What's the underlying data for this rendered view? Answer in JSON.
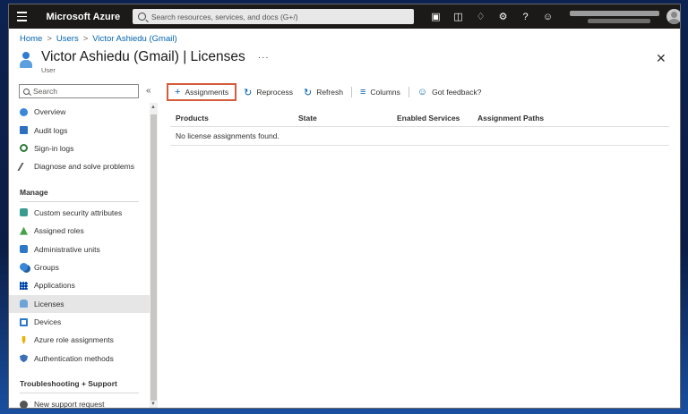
{
  "topbar": {
    "brand": "Microsoft Azure",
    "search_placeholder": "Search resources, services, and docs (G+/)",
    "icons": [
      "cloud-shell-icon",
      "directory-filter-icon",
      "notifications-icon",
      "settings-icon",
      "help-icon",
      "feedback-icon"
    ]
  },
  "breadcrumb": [
    "Home",
    "Users",
    "Victor Ashiedu (Gmail)"
  ],
  "header": {
    "title": "Victor Ashiedu (Gmail) | Licenses",
    "subtitle": "User",
    "more": "···"
  },
  "sidebar": {
    "search_placeholder": "Search",
    "collapse": "«",
    "items_top": [
      {
        "label": "Overview",
        "icon": "overview-icon"
      },
      {
        "label": "Audit logs",
        "icon": "audit-logs-icon"
      },
      {
        "label": "Sign-in logs",
        "icon": "sign-in-logs-icon"
      },
      {
        "label": "Diagnose and solve problems",
        "icon": "diagnose-icon"
      }
    ],
    "section_manage": "Manage",
    "items_manage": [
      {
        "label": "Custom security attributes",
        "icon": "security-attributes-icon"
      },
      {
        "label": "Assigned roles",
        "icon": "assigned-roles-icon"
      },
      {
        "label": "Administrative units",
        "icon": "administrative-units-icon"
      },
      {
        "label": "Groups",
        "icon": "groups-icon"
      },
      {
        "label": "Applications",
        "icon": "applications-icon"
      },
      {
        "label": "Licenses",
        "icon": "licenses-icon"
      },
      {
        "label": "Devices",
        "icon": "devices-icon"
      },
      {
        "label": "Azure role assignments",
        "icon": "azure-role-icon"
      },
      {
        "label": "Authentication methods",
        "icon": "authentication-icon"
      }
    ],
    "section_support": "Troubleshooting + Support",
    "items_support": [
      {
        "label": "New support request",
        "icon": "support-request-icon"
      }
    ]
  },
  "toolbar": {
    "assignments": "Assignments",
    "reprocess": "Reprocess",
    "refresh": "Refresh",
    "columns": "Columns",
    "feedback": "Got feedback?"
  },
  "grid": {
    "columns": [
      "Products",
      "State",
      "Enabled Services",
      "Assignment Paths"
    ],
    "empty_message": "No license assignments found."
  },
  "colors": {
    "topbar": "#1b1a19",
    "link": "#0063b1",
    "highlight_box": "#d45d3c",
    "active_nav": "#e6e6e6"
  }
}
